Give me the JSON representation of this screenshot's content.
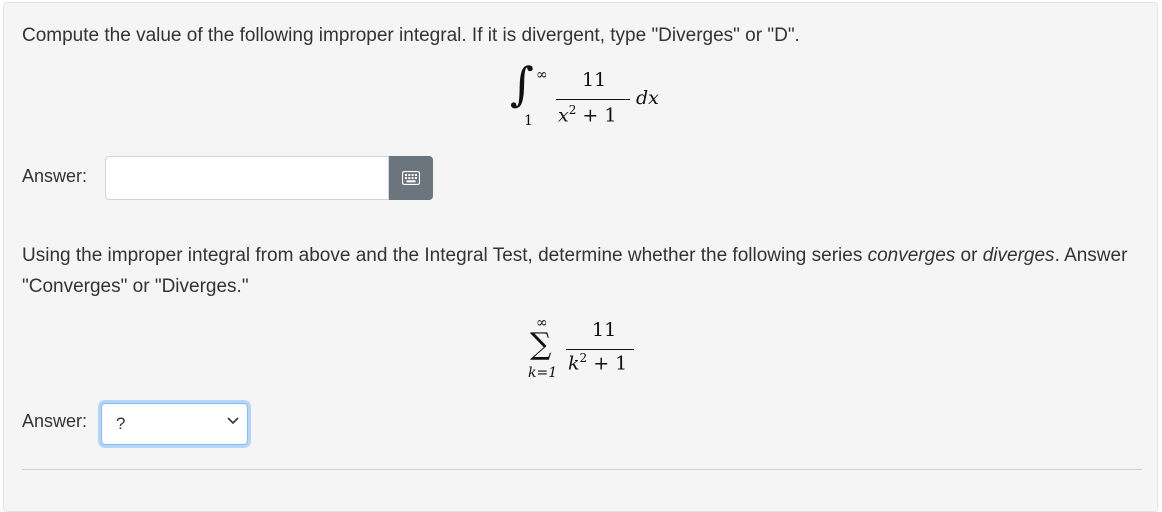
{
  "question1": {
    "prompt": "Compute the value of the following improper integral. If it is divergent, type \"Diverges\" or \"D\".",
    "integral": {
      "upper_limit": "∞",
      "lower_limit": "1",
      "numerator": "11",
      "denominator_base": "x",
      "denominator_exp": "2",
      "denominator_rest": " + 1",
      "differential": "dx"
    },
    "answer_label": "Answer:",
    "answer_value": ""
  },
  "question2": {
    "prompt_part1": "Using the improper integral from above and the Integral Test, determine whether the following series ",
    "prompt_em1": "converges",
    "prompt_part2": " or ",
    "prompt_em2": "diverges",
    "prompt_part3": ". Answer \"Converges\" or \"Diverges.\"",
    "series": {
      "upper_limit": "∞",
      "lower_limit": "k=1",
      "numerator": "11",
      "denominator_base": "k",
      "denominator_exp": "2",
      "denominator_rest": " + 1"
    },
    "answer_label": "Answer:",
    "select_value": "?"
  },
  "icons": {
    "keypad": "keyboard-icon",
    "dropdown": "chevron-down-icon"
  },
  "colors": {
    "panel_bg": "#f5f5f5",
    "keypad_button": "#6c757d",
    "focus_border": "#80bdff"
  }
}
